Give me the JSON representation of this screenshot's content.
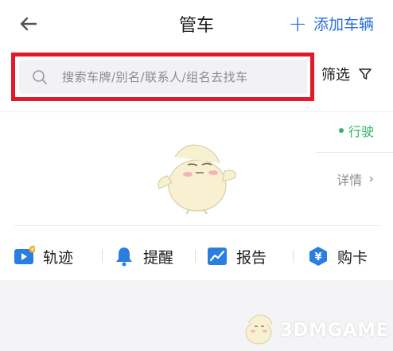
{
  "header": {
    "title": "管车",
    "add_vehicle_label": "添加车辆"
  },
  "search": {
    "placeholder": "搜索车牌/别名/联系人/组名去找车"
  },
  "filter": {
    "label": "筛选"
  },
  "vehicle_card": {
    "status": "行驶",
    "details_label": "详情"
  },
  "actions": [
    {
      "label": "轨迹",
      "icon": "play-icon",
      "color": "#2a7de1"
    },
    {
      "label": "提醒",
      "icon": "bell-icon",
      "color": "#2a7de1"
    },
    {
      "label": "报告",
      "icon": "chart-icon",
      "color": "#2a7de1"
    },
    {
      "label": "购卡",
      "icon": "yen-icon",
      "color": "#2a7de1"
    }
  ],
  "watermark": {
    "text": "3DMGAME"
  },
  "colors": {
    "accent": "#2b6fd6",
    "highlight_border": "#e3192b",
    "status_green": "#2fb56a"
  }
}
